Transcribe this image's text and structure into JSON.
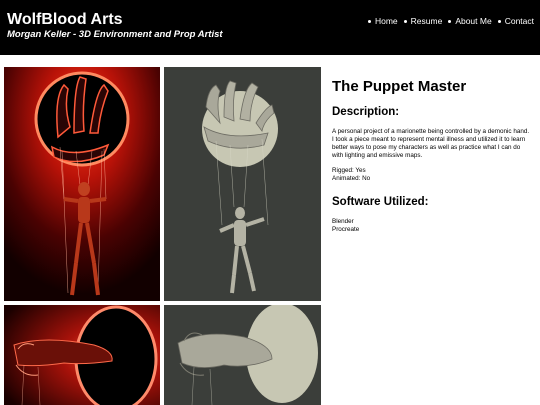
{
  "header": {
    "brand": "WolfBlood Arts",
    "tagline": "Morgan Keller - 3D Environment and Prop Artist",
    "nav": [
      "Home",
      "Resume",
      "About Me",
      "Contact"
    ]
  },
  "project": {
    "title": "The Puppet Master",
    "description_heading": "Description:",
    "description": "A personal project of a marionette being controlled by a demonic hand. I took a piece meant to represent mental illness and utilized it to learn better ways to pose my characters as well as practice what I can do with lighting and emissive maps.",
    "rigged": "Rigged: Yes",
    "animated": "Animated: No",
    "software_heading": "Software Utilized:",
    "software": [
      "Blender",
      "Procreate"
    ]
  },
  "gallery": {
    "images": [
      {
        "name": "puppet-master-render-red",
        "palette": [
          "#1a0000",
          "#c0180a",
          "#ff6a3a"
        ]
      },
      {
        "name": "puppet-master-clay-grey",
        "palette": [
          "#3d403c",
          "#c9c9b5",
          "#aaa99a"
        ]
      },
      {
        "name": "demonic-hand-closeup-red",
        "palette": [
          "#1a0000",
          "#b4140a",
          "#ff7a5a"
        ]
      },
      {
        "name": "demonic-hand-closeup-clay",
        "palette": [
          "#3d403c",
          "#c9c9b5",
          "#9e9d90"
        ]
      }
    ]
  }
}
